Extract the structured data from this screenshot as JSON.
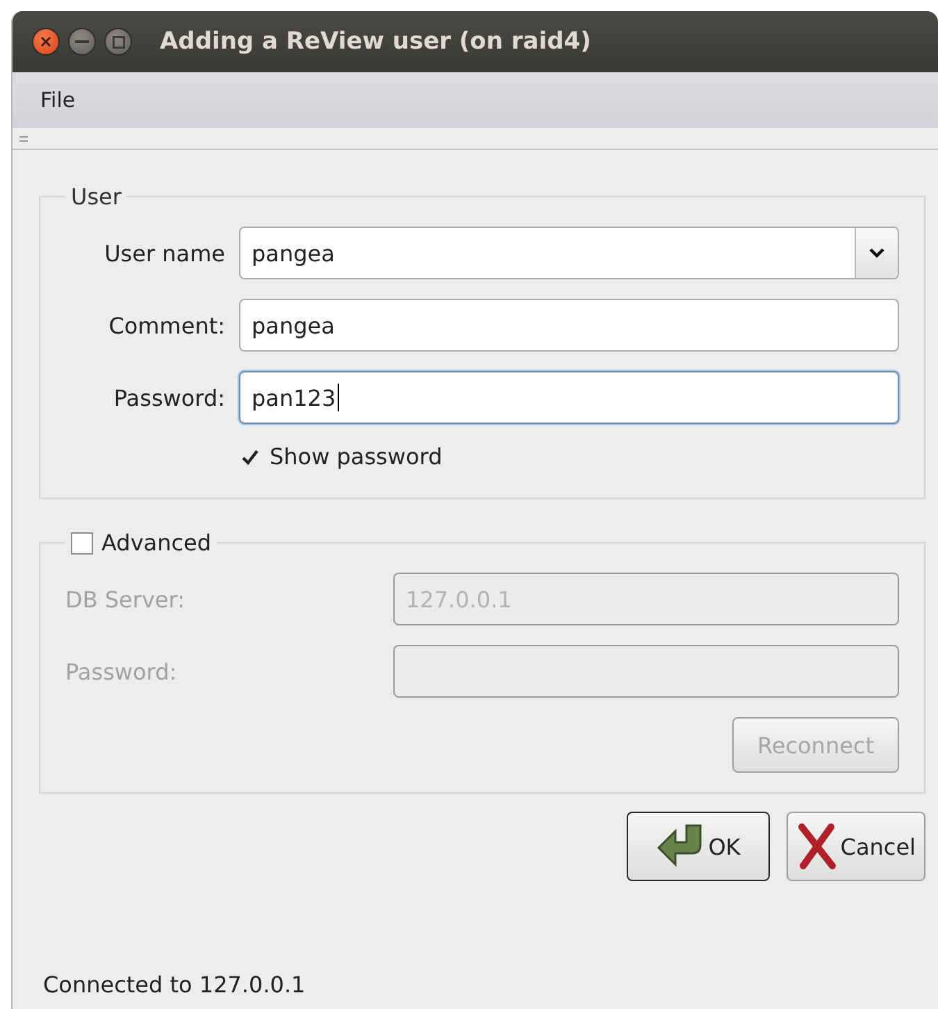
{
  "window": {
    "title": "Adding a ReView user (on raid4)"
  },
  "menu": [
    {
      "label": "File"
    }
  ],
  "user_group": {
    "title": "User",
    "fields": [
      {
        "kind": "combo",
        "label": "User name",
        "value": "pangea",
        "focused": false
      },
      {
        "kind": "text",
        "label": "Comment:",
        "value": "pangea",
        "focused": false
      },
      {
        "kind": "password",
        "label": "Password:",
        "value": "pan123",
        "focused": true
      }
    ],
    "show_password": {
      "label": "Show password",
      "checked": true
    }
  },
  "advanced": {
    "label": "Advanced",
    "checked": false,
    "fields": [
      {
        "label": "DB Server:",
        "value": "127.0.0.1"
      },
      {
        "label": "Password:"
      }
    ],
    "reconnect": "Reconnect"
  },
  "buttons": [
    {
      "kind": "ok",
      "label": "OK",
      "default": true
    },
    {
      "kind": "cancel",
      "label": "Cancel",
      "default": false
    }
  ],
  "status_bar": "Connected to 127.0.0.1"
}
